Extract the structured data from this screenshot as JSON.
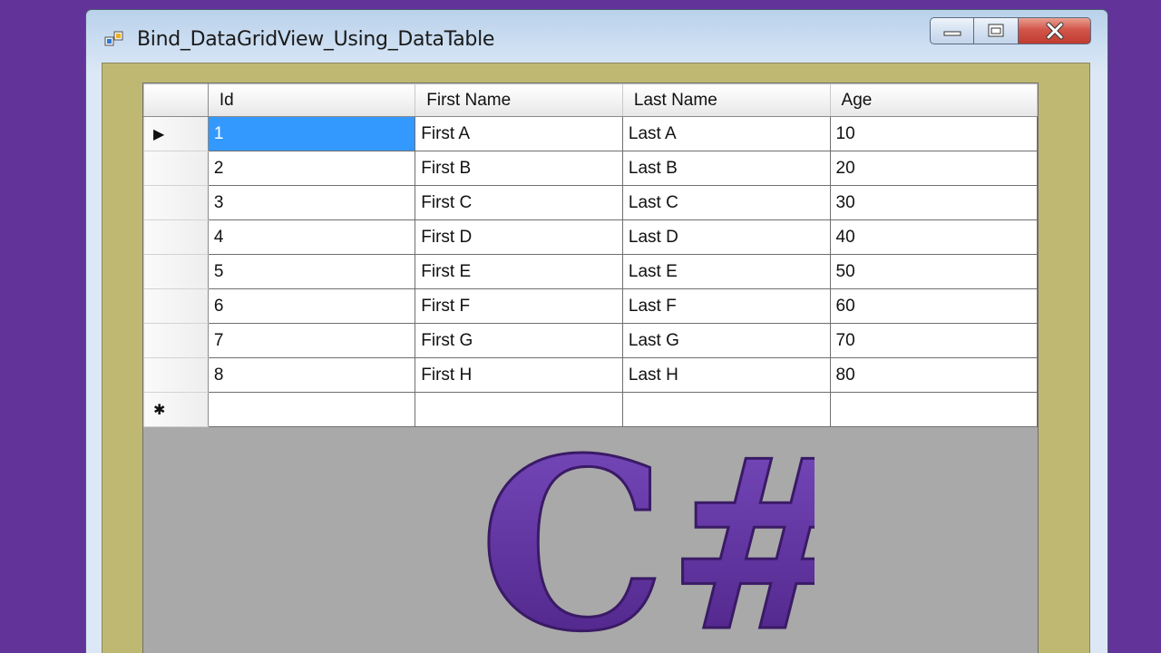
{
  "window": {
    "title": "Bind_DataGridView_Using_DataTable",
    "caption_buttons": {
      "minimize_icon": "minimize-icon",
      "maximize_icon": "maximize-icon",
      "close_icon": "close-icon"
    }
  },
  "grid": {
    "columns": [
      "Id",
      "First Name",
      "Last Name",
      "Age"
    ],
    "rows": [
      {
        "id": "1",
        "first": "First A",
        "last": "Last A",
        "age": "10"
      },
      {
        "id": "2",
        "first": "First B",
        "last": "Last B",
        "age": "20"
      },
      {
        "id": "3",
        "first": "First C",
        "last": "Last C",
        "age": "30"
      },
      {
        "id": "4",
        "first": "First D",
        "last": "Last D",
        "age": "40"
      },
      {
        "id": "5",
        "first": "First E",
        "last": "Last E",
        "age": "50"
      },
      {
        "id": "6",
        "first": "First F",
        "last": "Last F",
        "age": "60"
      },
      {
        "id": "7",
        "first": "First G",
        "last": "Last G",
        "age": "70"
      },
      {
        "id": "8",
        "first": "First H",
        "last": "Last H",
        "age": "80"
      }
    ],
    "current_row_indicator": "▶",
    "new_row_indicator": "✱",
    "selection_color": "#3399ff"
  },
  "overlay": {
    "logo_text": "C#",
    "logo_color": "#5a2d98"
  },
  "colors": {
    "background": "#62349a",
    "form_back": "#bfb872",
    "grid_back": "#a9a9a9"
  }
}
